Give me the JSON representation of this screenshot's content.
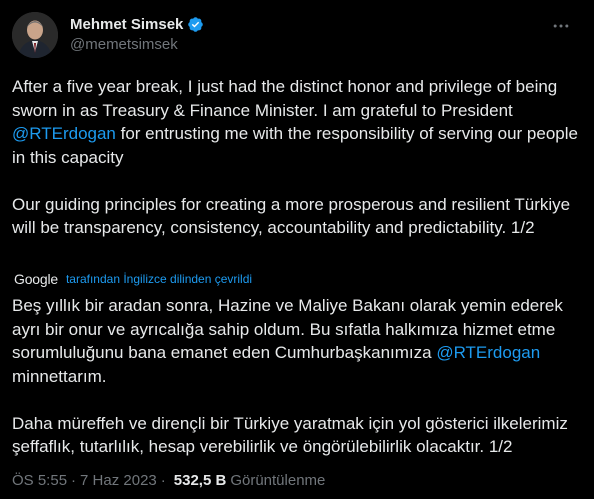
{
  "author": {
    "display_name": "Mehmet Simsek",
    "handle": "@memetsimsek"
  },
  "original": {
    "p1_before": "After a five year break, I just had the distinct honor and privilege of being sworn in as Treasury & Finance Minister. I am grateful to President ",
    "p1_mention": "@RTErdogan",
    "p1_after": " for entrusting me with the responsibility of serving our people in this capacity",
    "p2": "Our guiding principles for creating a more prosperous and resilient Türkiye will be transparency, consistency, accountability and predictability. 1/2"
  },
  "translation": {
    "provider": "Google",
    "link_label": "tarafından İngilizce dilinden çevrildi",
    "p1_before": "Beş yıllık bir aradan sonra, Hazine ve Maliye Bakanı olarak yemin ederek ayrı bir onur ve ayrıcalığa sahip oldum. Bu sıfatla halkımıza hizmet etme sorumluluğunu bana emanet eden Cumhurbaşkanımıza ",
    "p1_mention": "@RTErdogan",
    "p1_after": " minnettarım.",
    "p2": "Daha müreffeh ve dirençli bir Türkiye yaratmak için yol gösterici ilkelerimiz şeffaflık, tutarlılık, hesap verebilirlik ve öngörülebilirlik olacaktır. 1/2"
  },
  "meta": {
    "time": "ÖS 5:55",
    "separator1": "·",
    "date": "7 Haz 2023",
    "separator2": "·",
    "views_count": "532,5 B",
    "views_label": "Görüntülenme"
  },
  "icons": {
    "verified": "verified-badge-icon",
    "more": "more-options-icon"
  },
  "colors": {
    "background": "#000000",
    "text": "#e7e9ea",
    "secondary": "#71767b",
    "accent": "#1d9bf0"
  }
}
